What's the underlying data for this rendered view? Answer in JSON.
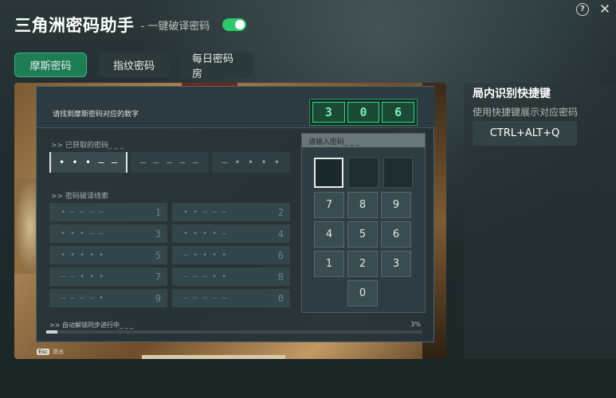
{
  "app": {
    "title": "三角洲密码助手",
    "subtitle": "- 一键破译密码",
    "auto_toggle_on": true
  },
  "window": {
    "help_icon": "question-circle-icon",
    "help_glyph": "?",
    "close_icon": "close-icon",
    "close_glyph": "✕"
  },
  "tabs": [
    {
      "label": "摩斯密码",
      "active": true
    },
    {
      "label": "指纹密码",
      "active": false
    },
    {
      "label": "每日密码房",
      "active": false
    }
  ],
  "puzzle": {
    "instruction": "请找到摩斯密码对应的数字",
    "code_digits": [
      "3",
      "0",
      "6"
    ],
    "obtained_label": ">> 已获取的密码_ _ _",
    "obtained_slots": [
      "• • • – –",
      "– – – – –",
      "– • • • •"
    ],
    "clues_label": ">> 密码破译线索",
    "clues": [
      {
        "code": "• – – – –",
        "digit": "1"
      },
      {
        "code": "• • – – –",
        "digit": "2"
      },
      {
        "code": "• • • – –",
        "digit": "3"
      },
      {
        "code": "• • • • –",
        "digit": "4"
      },
      {
        "code": "• • • • •",
        "digit": "5"
      },
      {
        "code": "– • • • •",
        "digit": "6"
      },
      {
        "code": "– – • • •",
        "digit": "7"
      },
      {
        "code": "– – – • •",
        "digit": "8"
      },
      {
        "code": "– – – – •",
        "digit": "9"
      },
      {
        "code": "– – – – –",
        "digit": "0"
      }
    ],
    "keypad_label": "请输入密码_ _ _",
    "keys": [
      "7",
      "8",
      "9",
      "4",
      "5",
      "6",
      "1",
      "2",
      "3",
      "0"
    ],
    "progress_text": ">> 自动解锁同步进行中_ _ _",
    "progress_pct": "3%",
    "progress_value": 0.03,
    "esc_key": "Esc",
    "esc_label": "退出"
  },
  "side": {
    "title": "局内识别快捷键",
    "description": "使用快捷键展示对应密码",
    "shortcut": "CTRL+ALT+Q"
  },
  "colors": {
    "accent_green": "#1f7d55",
    "toggle_green": "#2ec96b",
    "code_green": "#7ff0b5"
  }
}
